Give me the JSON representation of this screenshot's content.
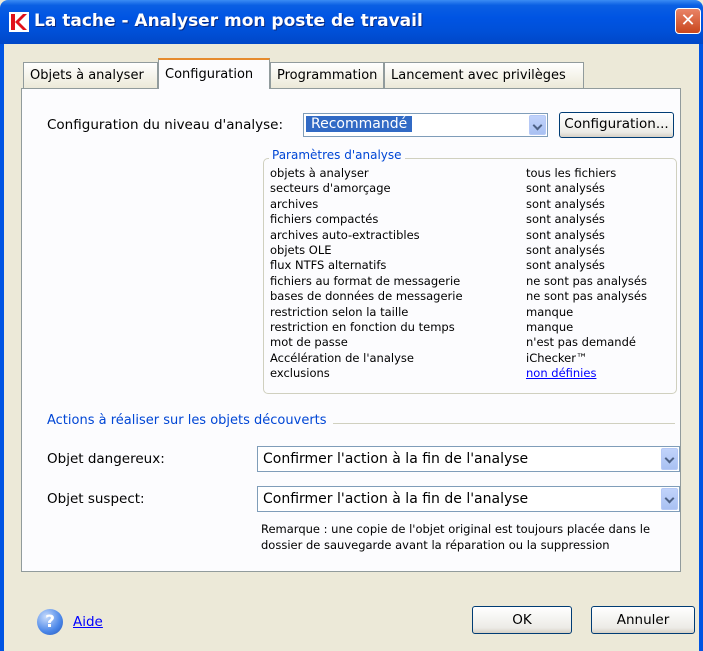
{
  "window": {
    "title": "La tache - Analyser mon poste de travail",
    "close_glyph": "✕"
  },
  "tabs": [
    {
      "label": "Objets à analyser",
      "active": false
    },
    {
      "label": "Configuration",
      "active": true
    },
    {
      "label": "Programmation",
      "active": false
    },
    {
      "label": "Lancement avec privilèges",
      "active": false
    }
  ],
  "config": {
    "level_label": "Configuration du niveau d'analyse:",
    "level_value": "Recommandé",
    "config_button": "Configuration..."
  },
  "params": {
    "title": "Paramètres d'analyse",
    "rows": [
      {
        "name": "objets à analyser",
        "value": "tous les fichiers"
      },
      {
        "name": "secteurs d'amorçage",
        "value": "sont analysés"
      },
      {
        "name": "archives",
        "value": "sont analysés"
      },
      {
        "name": "fichiers compactés",
        "value": "sont analysés"
      },
      {
        "name": "archives auto-extractibles",
        "value": "sont analysés"
      },
      {
        "name": "objets OLE",
        "value": "sont analysés"
      },
      {
        "name": "flux NTFS alternatifs",
        "value": "sont analysés"
      },
      {
        "name": "fichiers au format de messagerie",
        "value": "ne sont pas analysés"
      },
      {
        "name": "bases de données de messagerie",
        "value": "ne sont pas analysés"
      },
      {
        "name": "restriction selon la taille",
        "value": "manque"
      },
      {
        "name": "restriction en fonction du temps",
        "value": "manque"
      },
      {
        "name": "mot de passe",
        "value": "n'est pas demandé"
      },
      {
        "name": "Accélération de l'analyse",
        "value": "iChecker™"
      },
      {
        "name": "exclusions",
        "value": "non définies"
      }
    ]
  },
  "actions": {
    "title": "Actions à réaliser sur les objets découverts",
    "dangerous_label": "Objet dangereux:",
    "dangerous_value": "Confirmer l'action à la fin de l'analyse",
    "suspect_label": "Objet suspect:",
    "suspect_value": "Confirmer l'action à la fin de l'analyse",
    "note": "Remarque : une copie de l'objet original est toujours placée dans le dossier de sauvegarde avant la réparation ou la suppression"
  },
  "footer": {
    "help_glyph": "?",
    "help_label": "Aide",
    "ok_label": "OK",
    "cancel_label": "Annuler"
  },
  "colors": {
    "titlebar": "#0054e3",
    "section_title": "#0046d5",
    "selection": "#316ac5",
    "link": "#0000ff"
  }
}
